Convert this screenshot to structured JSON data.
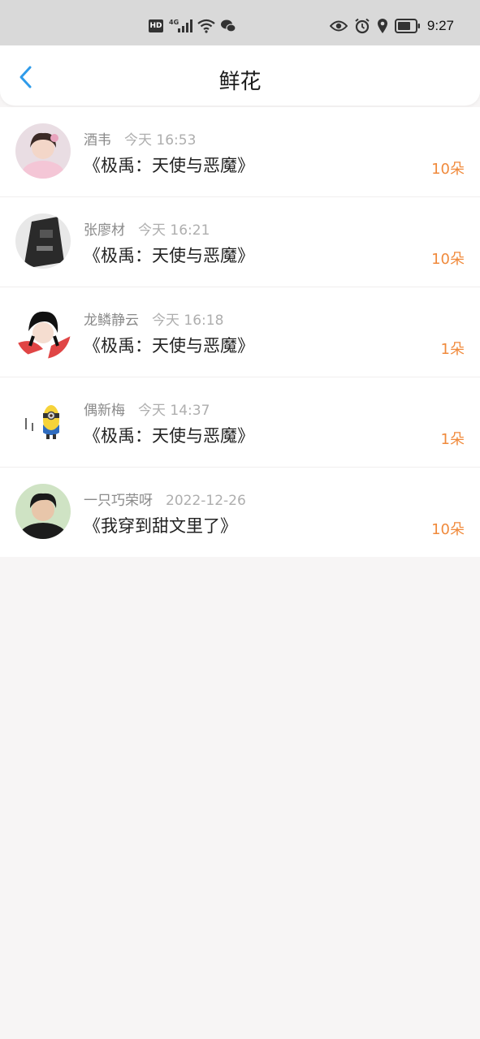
{
  "status_bar": {
    "hd": "HD",
    "network": "4G",
    "time": "9:27"
  },
  "header": {
    "title": "鲜花"
  },
  "items": [
    {
      "name": "酒韦",
      "time": "今天 16:53",
      "book": "《极禹：天使与恶魔》",
      "count": "10朵"
    },
    {
      "name": "张廖材",
      "time": "今天 16:21",
      "book": "《极禹：天使与恶魔》",
      "count": "10朵"
    },
    {
      "name": "龙鳞静云",
      "time": "今天 16:18",
      "book": "《极禹：天使与恶魔》",
      "count": "1朵"
    },
    {
      "name": "偶新梅",
      "time": "今天 14:37",
      "book": "《极禹：天使与恶魔》",
      "count": "1朵"
    },
    {
      "name": "一只巧荣呀",
      "time": "2022-12-26",
      "book": "《我穿到甜文里了》",
      "count": "10朵"
    }
  ],
  "colors": {
    "accent_blue": "#2f9bea",
    "count_orange": "#f08a3c"
  }
}
